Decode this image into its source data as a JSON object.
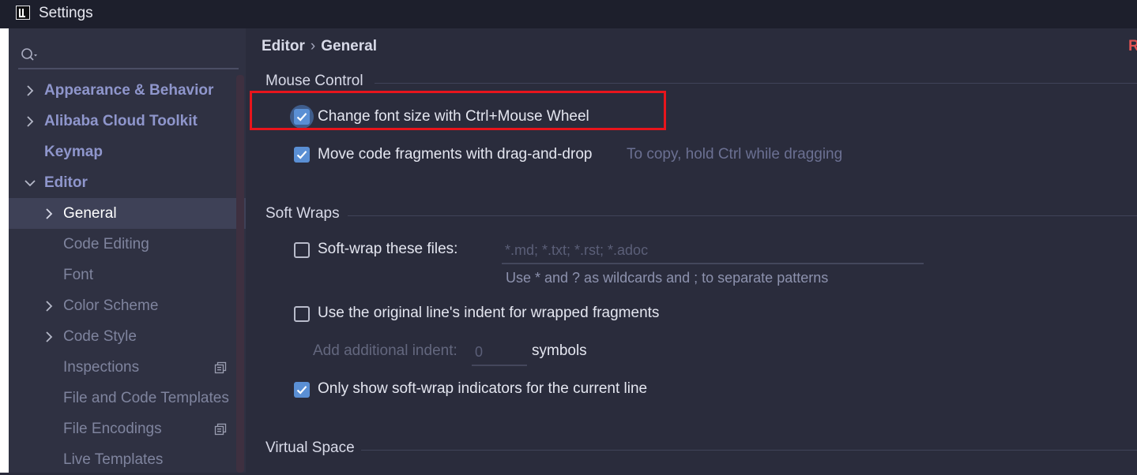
{
  "window": {
    "title": "Settings",
    "icon": "intellij-app-icon"
  },
  "search": {
    "placeholder": "",
    "value": ""
  },
  "sidebar": {
    "items": [
      {
        "label": "Appearance & Behavior",
        "chevron": "right"
      },
      {
        "label": "Alibaba Cloud Toolkit",
        "chevron": "right"
      },
      {
        "label": "Keymap",
        "chevron": "none"
      },
      {
        "label": "Editor",
        "chevron": "down"
      },
      {
        "label": "General",
        "chevron": "right",
        "selected": true
      },
      {
        "label": "Code Editing",
        "chevron": "none"
      },
      {
        "label": "Font",
        "chevron": "none"
      },
      {
        "label": "Color Scheme",
        "chevron": "right"
      },
      {
        "label": "Code Style",
        "chevron": "right"
      },
      {
        "label": "Inspections",
        "chevron": "none",
        "icon": "copy-icon"
      },
      {
        "label": "File and Code Templates",
        "chevron": "none"
      },
      {
        "label": "File Encodings",
        "chevron": "none",
        "icon": "copy-icon"
      },
      {
        "label": "Live Templates",
        "chevron": "none"
      }
    ]
  },
  "breadcrumb": {
    "parent": "Editor",
    "separator": "›",
    "current": "General"
  },
  "reset_label": "R",
  "sections": {
    "mouse_control": {
      "title": "Mouse Control",
      "change_font_size": {
        "label": "Change font size with Ctrl+Mouse Wheel",
        "checked": true
      },
      "move_fragments": {
        "label": "Move code fragments with drag-and-drop",
        "checked": true,
        "hint": "To copy, hold Ctrl while dragging"
      }
    },
    "soft_wraps": {
      "title": "Soft Wraps",
      "soft_wrap_files": {
        "label": "Soft-wrap these files:",
        "checked": false,
        "placeholder": "*.md; *.txt; *.rst; *.adoc",
        "hint": "Use * and ? as wildcards and ; to separate patterns"
      },
      "original_indent": {
        "label": "Use the original line's indent for wrapped fragments",
        "checked": false
      },
      "additional_indent": {
        "label": "Add additional indent:",
        "value": "0",
        "unit": "symbols"
      },
      "show_indicators": {
        "label": "Only show soft-wrap indicators for the current line",
        "checked": true
      }
    },
    "virtual_space": {
      "title": "Virtual Space"
    }
  },
  "colors": {
    "accent_checkbox": "#5a8fd4",
    "highlight_box": "#e8151c",
    "reset": "#e05252"
  }
}
